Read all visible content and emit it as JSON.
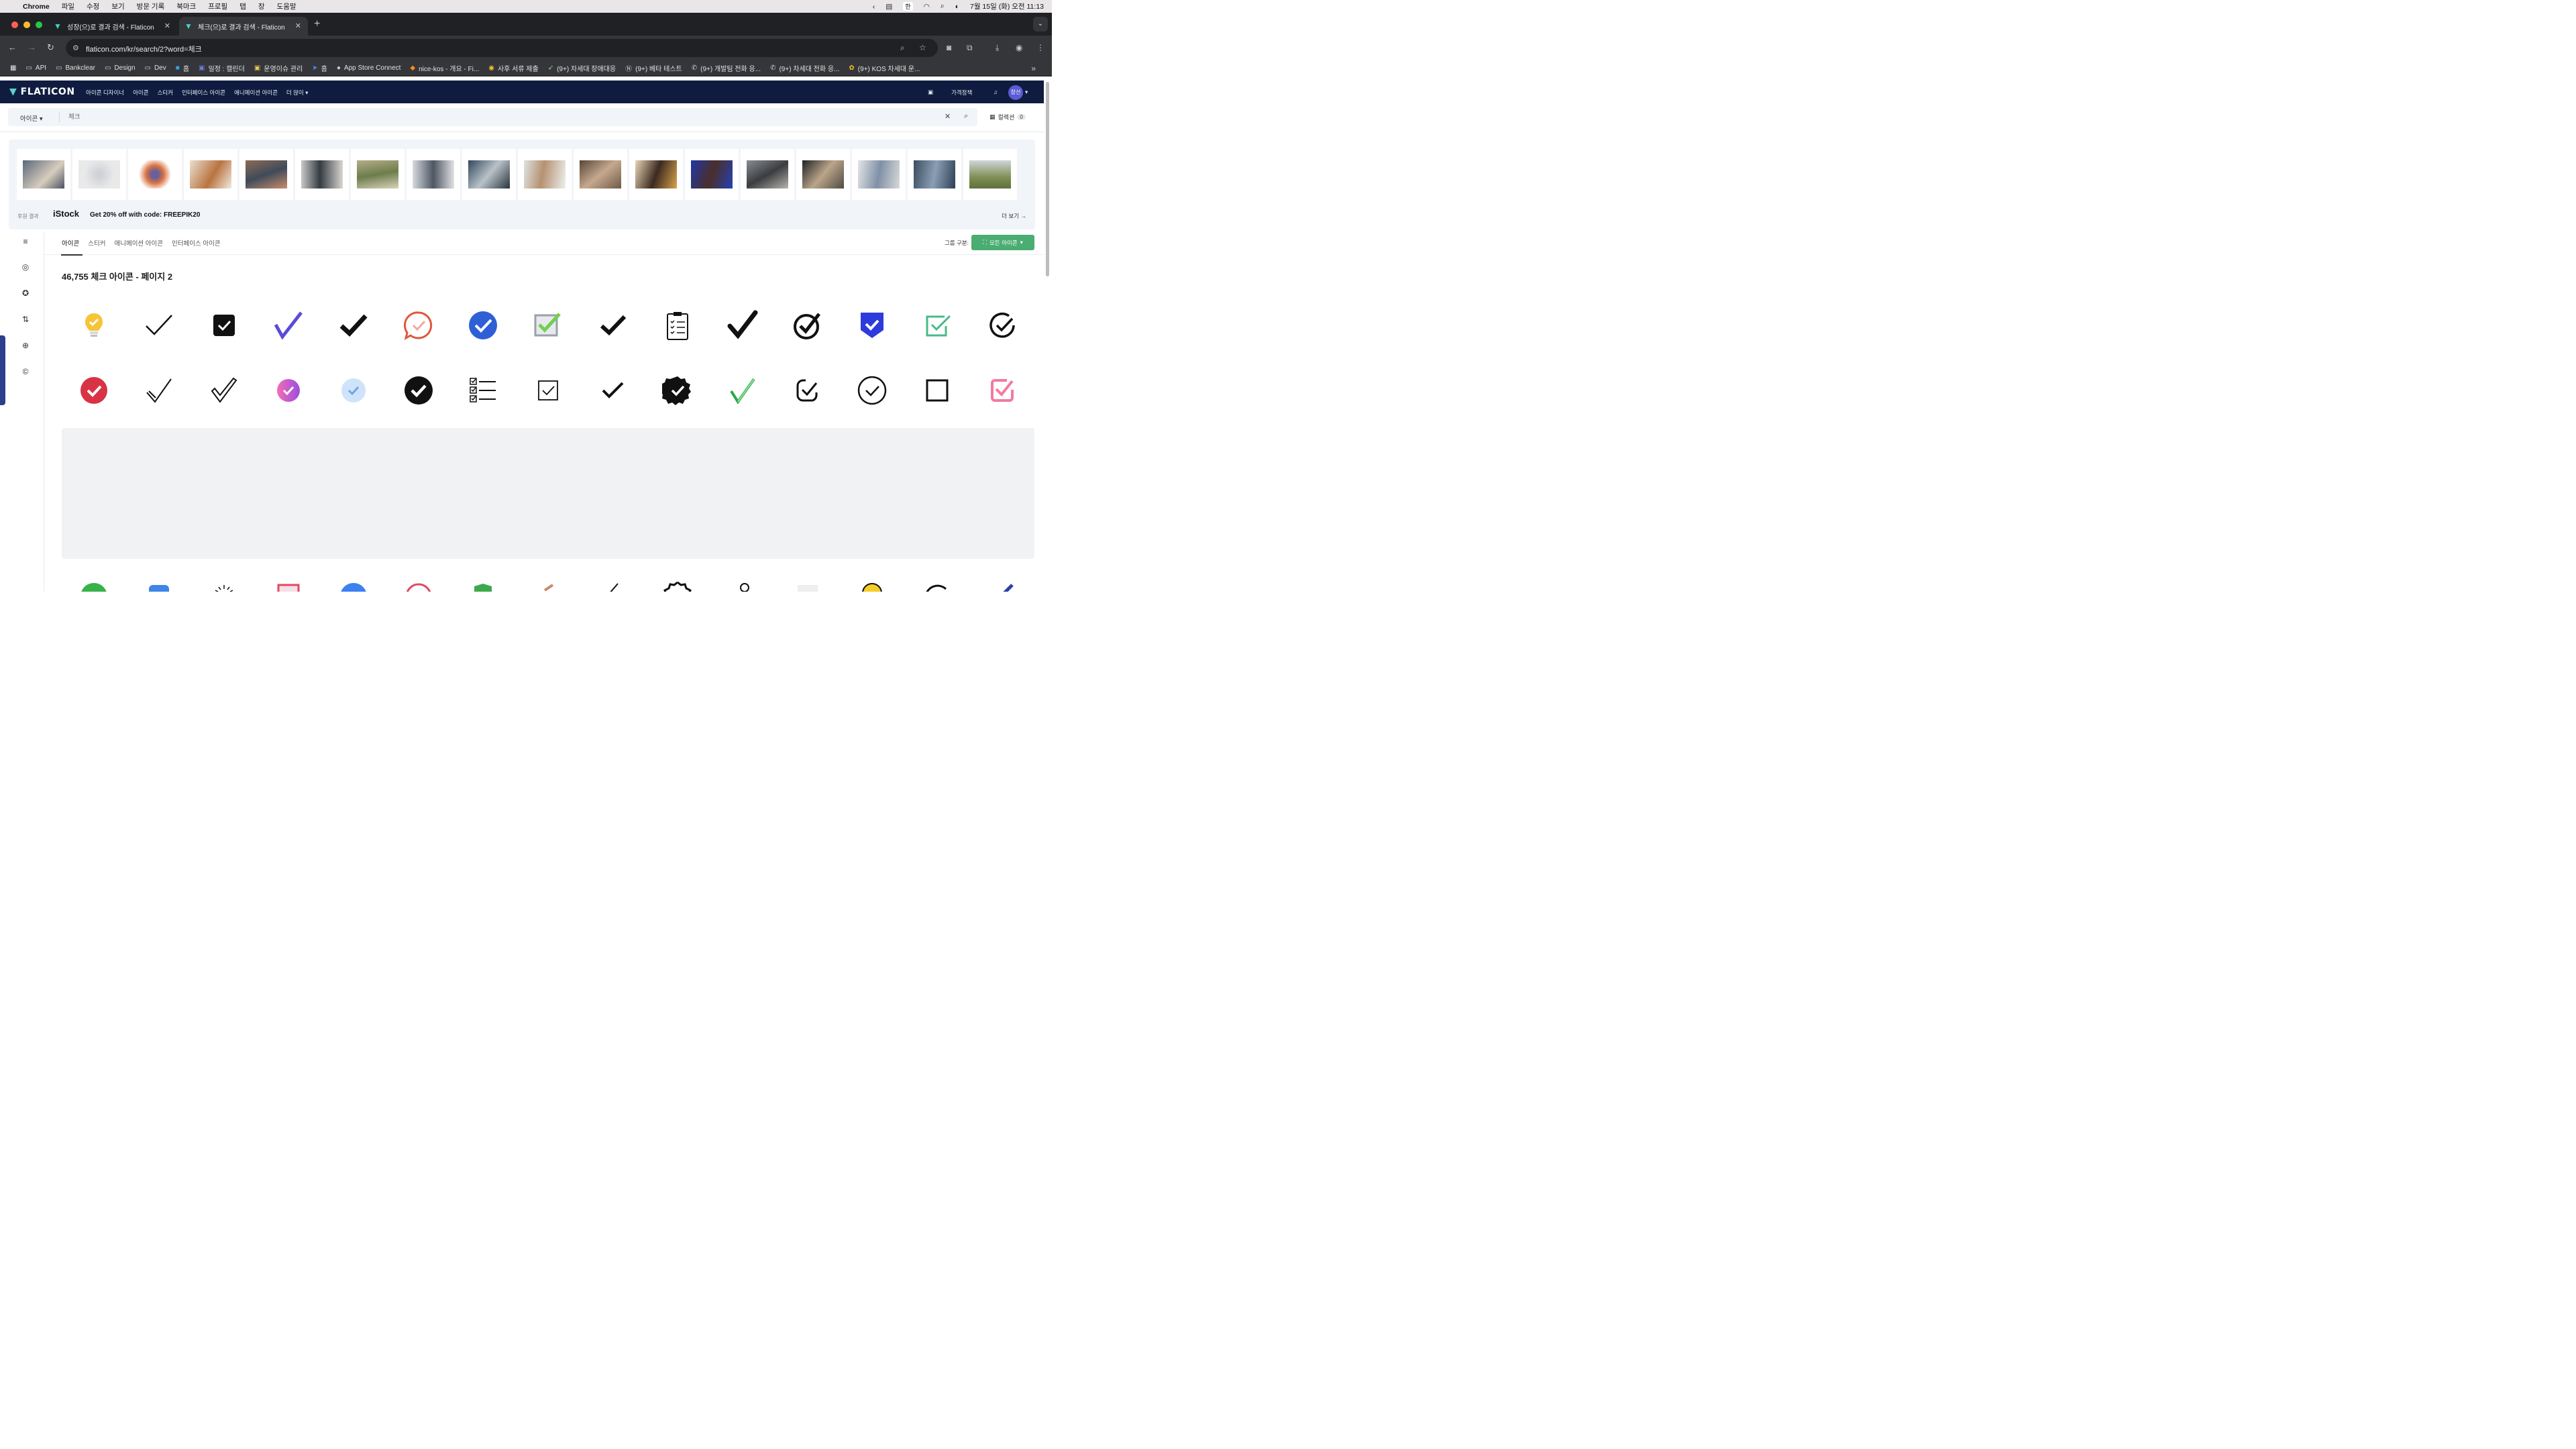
{
  "menubar": {
    "app": "Chrome",
    "items": [
      "파일",
      "수정",
      "보기",
      "방문 기록",
      "북마크",
      "프로필",
      "탭",
      "창",
      "도움말"
    ],
    "datetime": "7월 15일 (화) 오전 11:13",
    "ime": "한"
  },
  "tabs": [
    {
      "title": "성장(으)로 결과 검색 - Flaticon"
    },
    {
      "title": "체크(으)로 결과 검색 - Flaticon"
    }
  ],
  "address": {
    "url": "flaticon.com/kr/search/2?word=체크"
  },
  "bookmarks": [
    {
      "label": "API",
      "icon": "folder-icon"
    },
    {
      "label": "Bankclear",
      "icon": "folder-icon"
    },
    {
      "label": "Design",
      "icon": "folder-icon"
    },
    {
      "label": "Dev",
      "icon": "folder-icon"
    },
    {
      "label": "홈",
      "icon": "app-icon"
    },
    {
      "label": "일정 : 캘린더",
      "icon": "calendar-icon"
    },
    {
      "label": "운영이슈 관리",
      "icon": "app-icon"
    },
    {
      "label": "홈",
      "icon": "app-icon"
    },
    {
      "label": "App Store Connect",
      "icon": "apple-icon"
    },
    {
      "label": "nice-kos - 개요 - Fi...",
      "icon": "firebase-icon"
    },
    {
      "label": "사후 서류 제출",
      "icon": "app-icon"
    },
    {
      "label": "(9+) 차세대 장애대응",
      "icon": "app-icon"
    },
    {
      "label": "(9+) 베타 테스트",
      "icon": "notion-icon"
    },
    {
      "label": "(9+) 개발팀 전화 응...",
      "icon": "phone-icon"
    },
    {
      "label": "(9+) 차세대 전화 응...",
      "icon": "phone-icon"
    },
    {
      "label": "(9+) KOS 차세대 운...",
      "icon": "flower-icon"
    }
  ],
  "flaticon": {
    "logo": "FLATICON",
    "nav": [
      "아이콘 디자이너",
      "아이콘",
      "스티커",
      "인터페이스 아이콘",
      "애니메이션 아이콘",
      "더 많이"
    ],
    "pricing": "가격정책",
    "avatar": "창선"
  },
  "search": {
    "type": "아이콘",
    "value": "체크",
    "collection_label": "컬렉션",
    "collection_count": "0"
  },
  "istock": {
    "sponsor": "후원 결과",
    "logo": "iStock",
    "promo": "Get 20% off with code: FREEPIK20",
    "more": "더 보기"
  },
  "filters": {
    "tabs": [
      "아이콘",
      "스티커",
      "애니메이션 아이콘",
      "인터페이스 아이콘"
    ],
    "group_label": "그룹 구분:",
    "group_value": "모든 아이콘"
  },
  "results": {
    "title": "46,755 체크 아이콘 - 페이지 2"
  },
  "colors": {
    "nav_bg": "#0f1c3f",
    "accent_green": "#4aad71",
    "brand_teal": "#58d2c9"
  }
}
